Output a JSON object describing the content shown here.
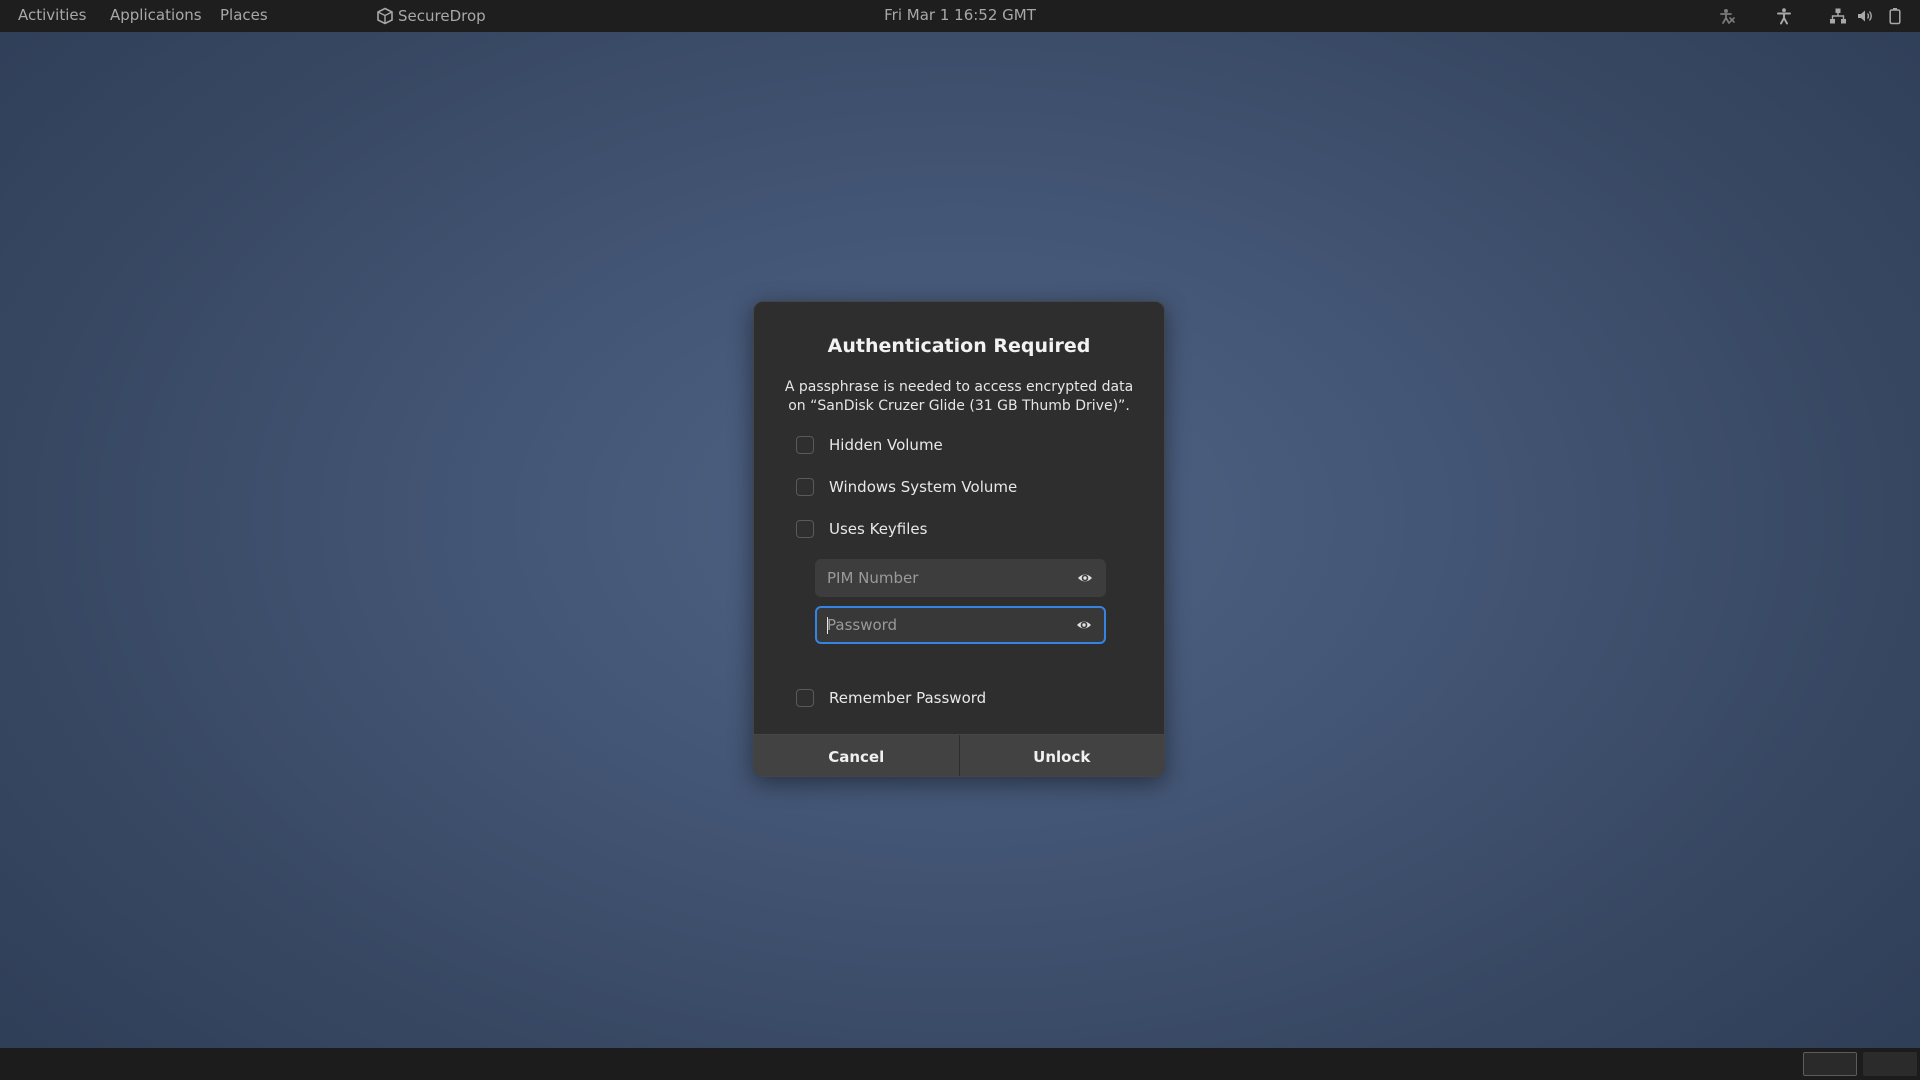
{
  "topbar": {
    "activities": "Activities",
    "applications": "Applications",
    "places": "Places",
    "app_name": "SecureDrop",
    "clock": "Fri Mar 1  16:52 GMT",
    "tray_icons": [
      "accessibility-extra-icon",
      "accessibility-icon",
      "network-icon",
      "volume-icon",
      "battery-icon"
    ]
  },
  "dialog": {
    "title": "Authentication Required",
    "description_line1": "A passphrase is needed to access encrypted data",
    "description_line2": "on “SanDisk Cruzer Glide (31 GB Thumb Drive)”.",
    "options": [
      {
        "label": "Hidden Volume",
        "checked": false
      },
      {
        "label": "Windows System Volume",
        "checked": false
      },
      {
        "label": "Uses Keyfiles",
        "checked": false
      }
    ],
    "pim": {
      "placeholder": "PIM Number",
      "value": ""
    },
    "password": {
      "placeholder": "Password",
      "value": "",
      "focused": true
    },
    "remember": {
      "label": "Remember Password",
      "checked": false
    },
    "buttons": {
      "cancel": "Cancel",
      "unlock": "Unlock"
    },
    "focus_color": "#3584e4"
  },
  "bottombar": {
    "workspaces": 2,
    "active_workspace": 1
  }
}
